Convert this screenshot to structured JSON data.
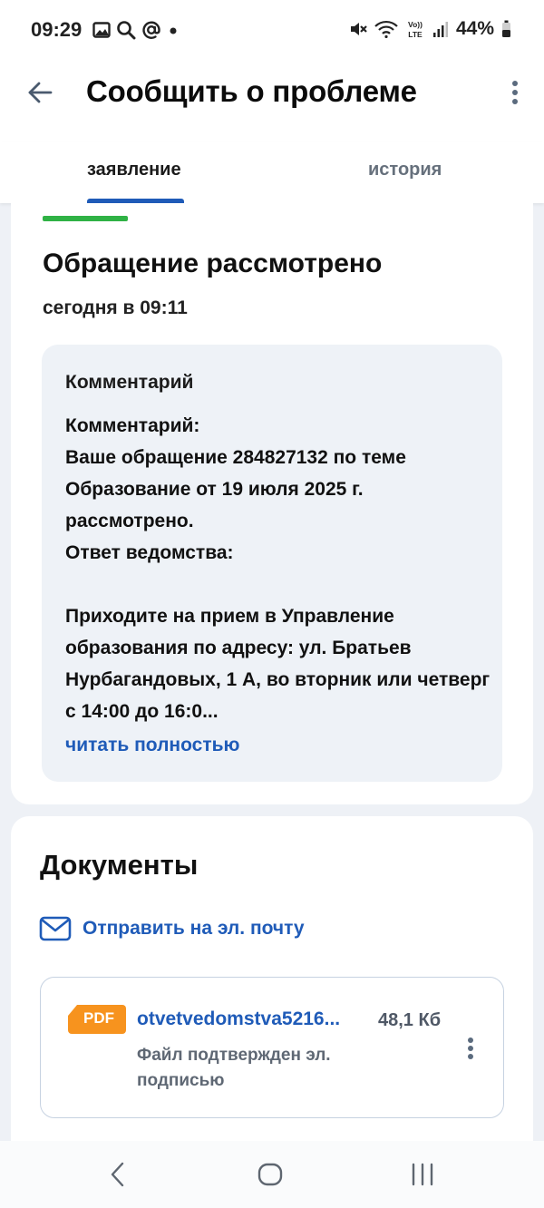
{
  "status_bar": {
    "time": "09:29",
    "battery_percent": "44%",
    "network_label": "LTE"
  },
  "header": {
    "title": "Сообщить о проблеме"
  },
  "tabs": [
    {
      "label": "заявление",
      "active": true
    },
    {
      "label": "история",
      "active": false
    }
  ],
  "status_card": {
    "title": "Обращение рассмотрено",
    "time": "сегодня в 09:11",
    "accent_color": "#2fb245",
    "comment": {
      "heading": "Комментарий",
      "body": "Комментарий:\nВаше обращение 284827132 по теме Образование от 19 июля 2025 г. рассмотрено.\nОтвет ведомства:\n\nПриходите на прием в Управление образования по адресу: ул. Братьев Нурбагандовых, 1 А, во вторник или четверг с 14:00 до 16:0...",
      "read_more": "читать полностью"
    }
  },
  "documents": {
    "title": "Документы",
    "email_link": "Отправить на эл. почту",
    "files": [
      {
        "badge": "PDF",
        "name": "otvetvedomstva5216...",
        "size": "48,1 Кб",
        "status": "Файл подтвержден эл. подписью"
      }
    ]
  },
  "colors": {
    "link": "#1f5bb8",
    "pdf_badge": "#f7931e",
    "success": "#2fb245"
  }
}
